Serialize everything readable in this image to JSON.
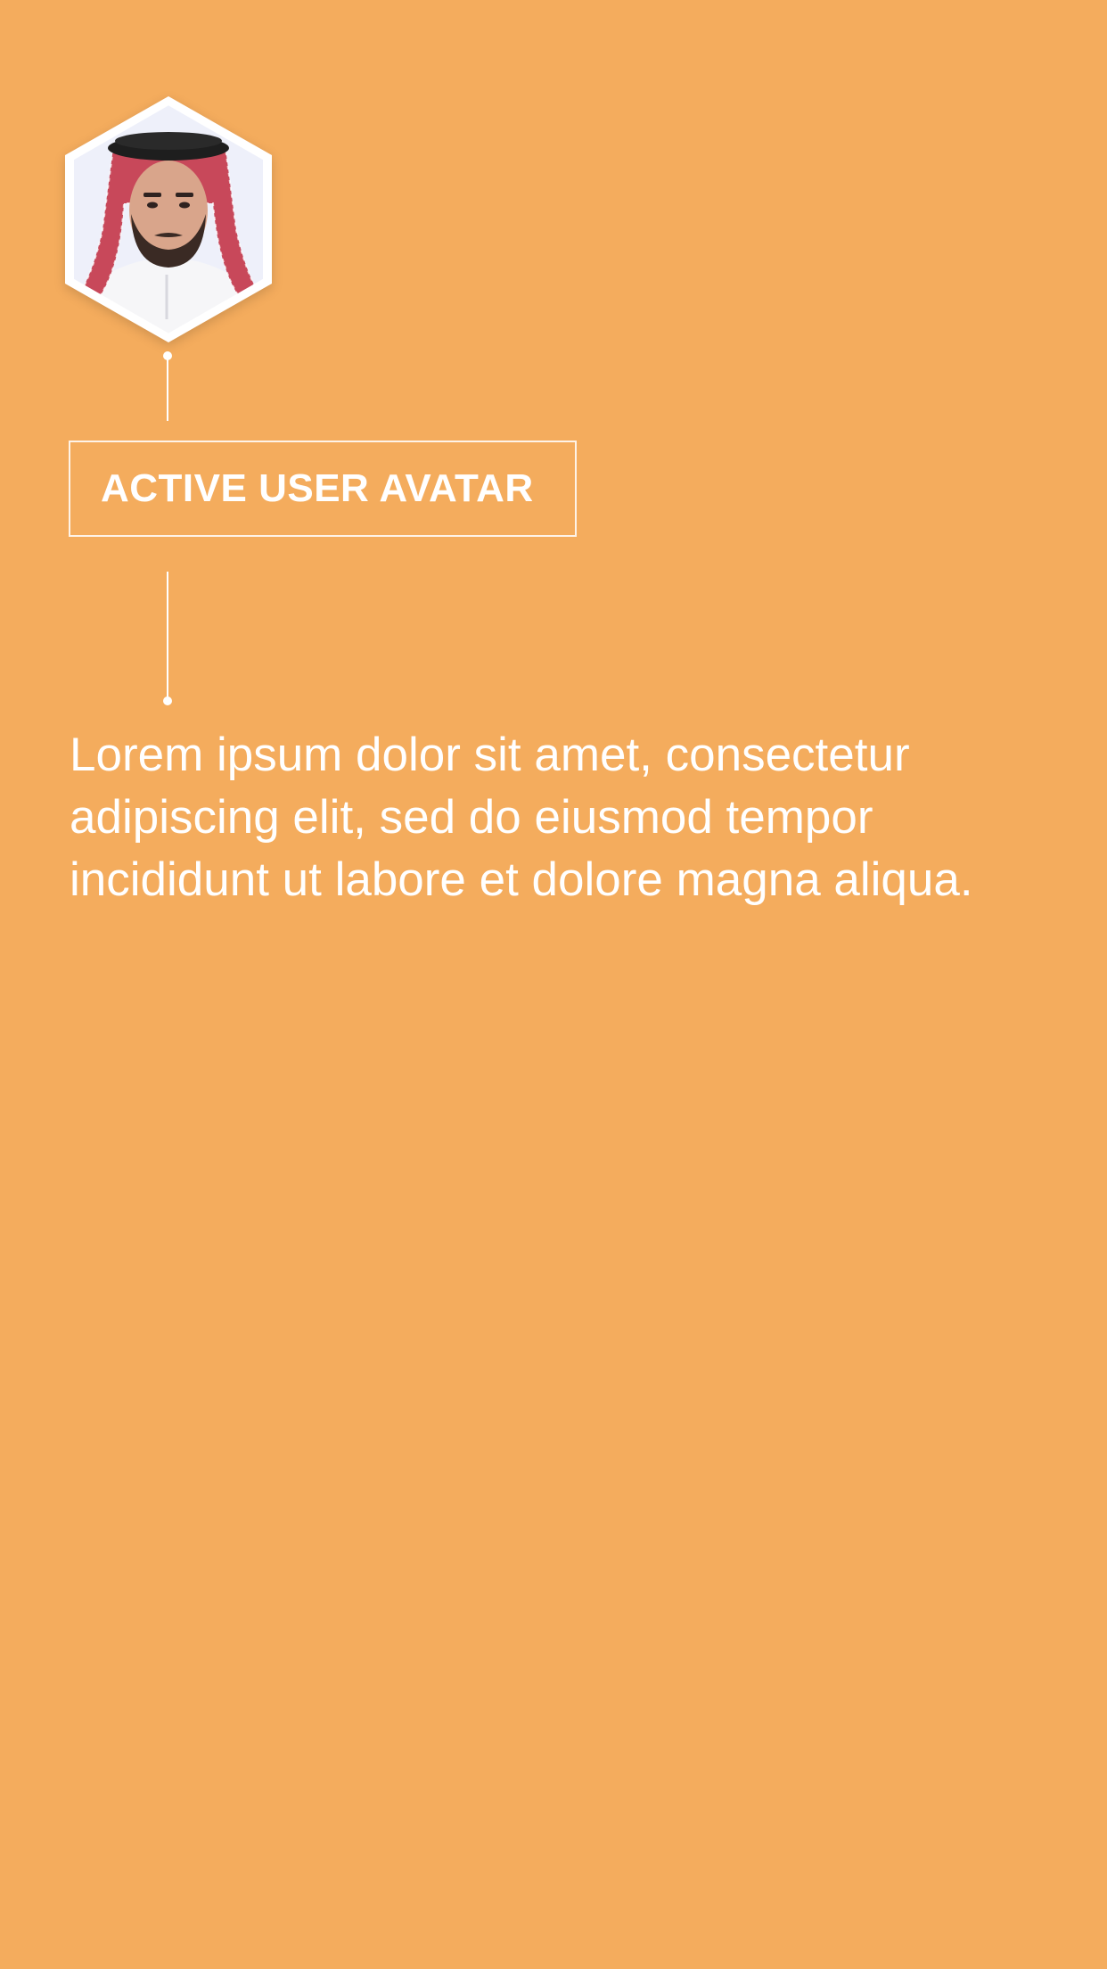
{
  "colors": {
    "background": "#F4AC5D",
    "foreground": "#FFFFFF"
  },
  "avatar": {
    "icon": "user-photo-hexagon"
  },
  "label": {
    "text": "ACTIVE USER AVATAR"
  },
  "description": {
    "text": "Lorem ipsum dolor sit amet, consectetur adipiscing elit, sed do eiusmod tempor incididunt ut labore et dolore magna aliqua."
  }
}
